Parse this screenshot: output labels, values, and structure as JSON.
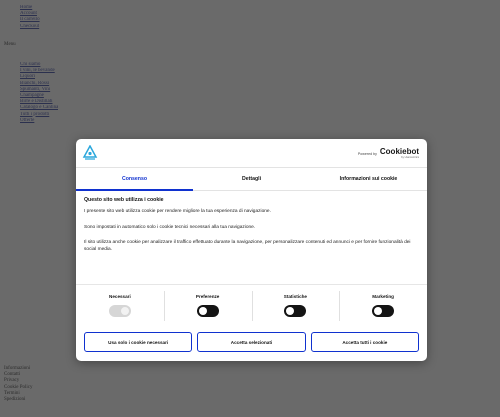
{
  "background": {
    "top_links": [
      "Home",
      "Account",
      "Il carrello",
      "Checkout"
    ],
    "menu_label": "Menu",
    "category_links": [
      "Chi siamo",
      "I vini, le bevande",
      "Liquori",
      "Bianchi, Rossi",
      "Spumanti, Vini",
      "Champagne",
      "Birre e Distillati",
      "Catalogo e Cantina",
      "Tutti i prodotti",
      "Offerte"
    ],
    "footer_lines": [
      "Informazioni",
      "Contatti",
      "Privacy",
      "Cookie Policy",
      "Termini",
      "Spedizioni"
    ]
  },
  "dialog": {
    "powered_label": "Powered by",
    "logo_text": "Cookiebot",
    "logo_sub": "by Usercentrics",
    "tabs": [
      {
        "label": "Consenso",
        "active": true
      },
      {
        "label": "Dettagli",
        "active": false
      },
      {
        "label": "Informazioni sui cookie",
        "active": false
      }
    ],
    "heading": "Questo sito web utilizza i cookie",
    "paragraphs": [
      "I presente sito web utilizza cookie per rendere migliore la tua esperienza di navigazione.",
      "Sono impostati in automatico solo i cookie tecnici necessari alla tua navigazione.",
      "Il sito utilizza anche cookie per analizzare il traffico effettuato durante la navigazione, per personalizzare contenuti ed annunci e per fornire funzionalità dei social media."
    ],
    "toggles": [
      {
        "label": "Necessari",
        "on": true,
        "disabled": true
      },
      {
        "label": "Preferenze",
        "on": false,
        "disabled": false
      },
      {
        "label": "Statistiche",
        "on": false,
        "disabled": false
      },
      {
        "label": "Marketing",
        "on": false,
        "disabled": false
      }
    ],
    "buttons": {
      "necessary_only": "Usa solo i cookie necessari",
      "accept_selected": "Accetta selezionati",
      "accept_all": "Accetta tutti i cookie"
    },
    "colors": {
      "accent": "#1032cf",
      "toggle_off": "#141414",
      "overlay": "#303030"
    }
  }
}
